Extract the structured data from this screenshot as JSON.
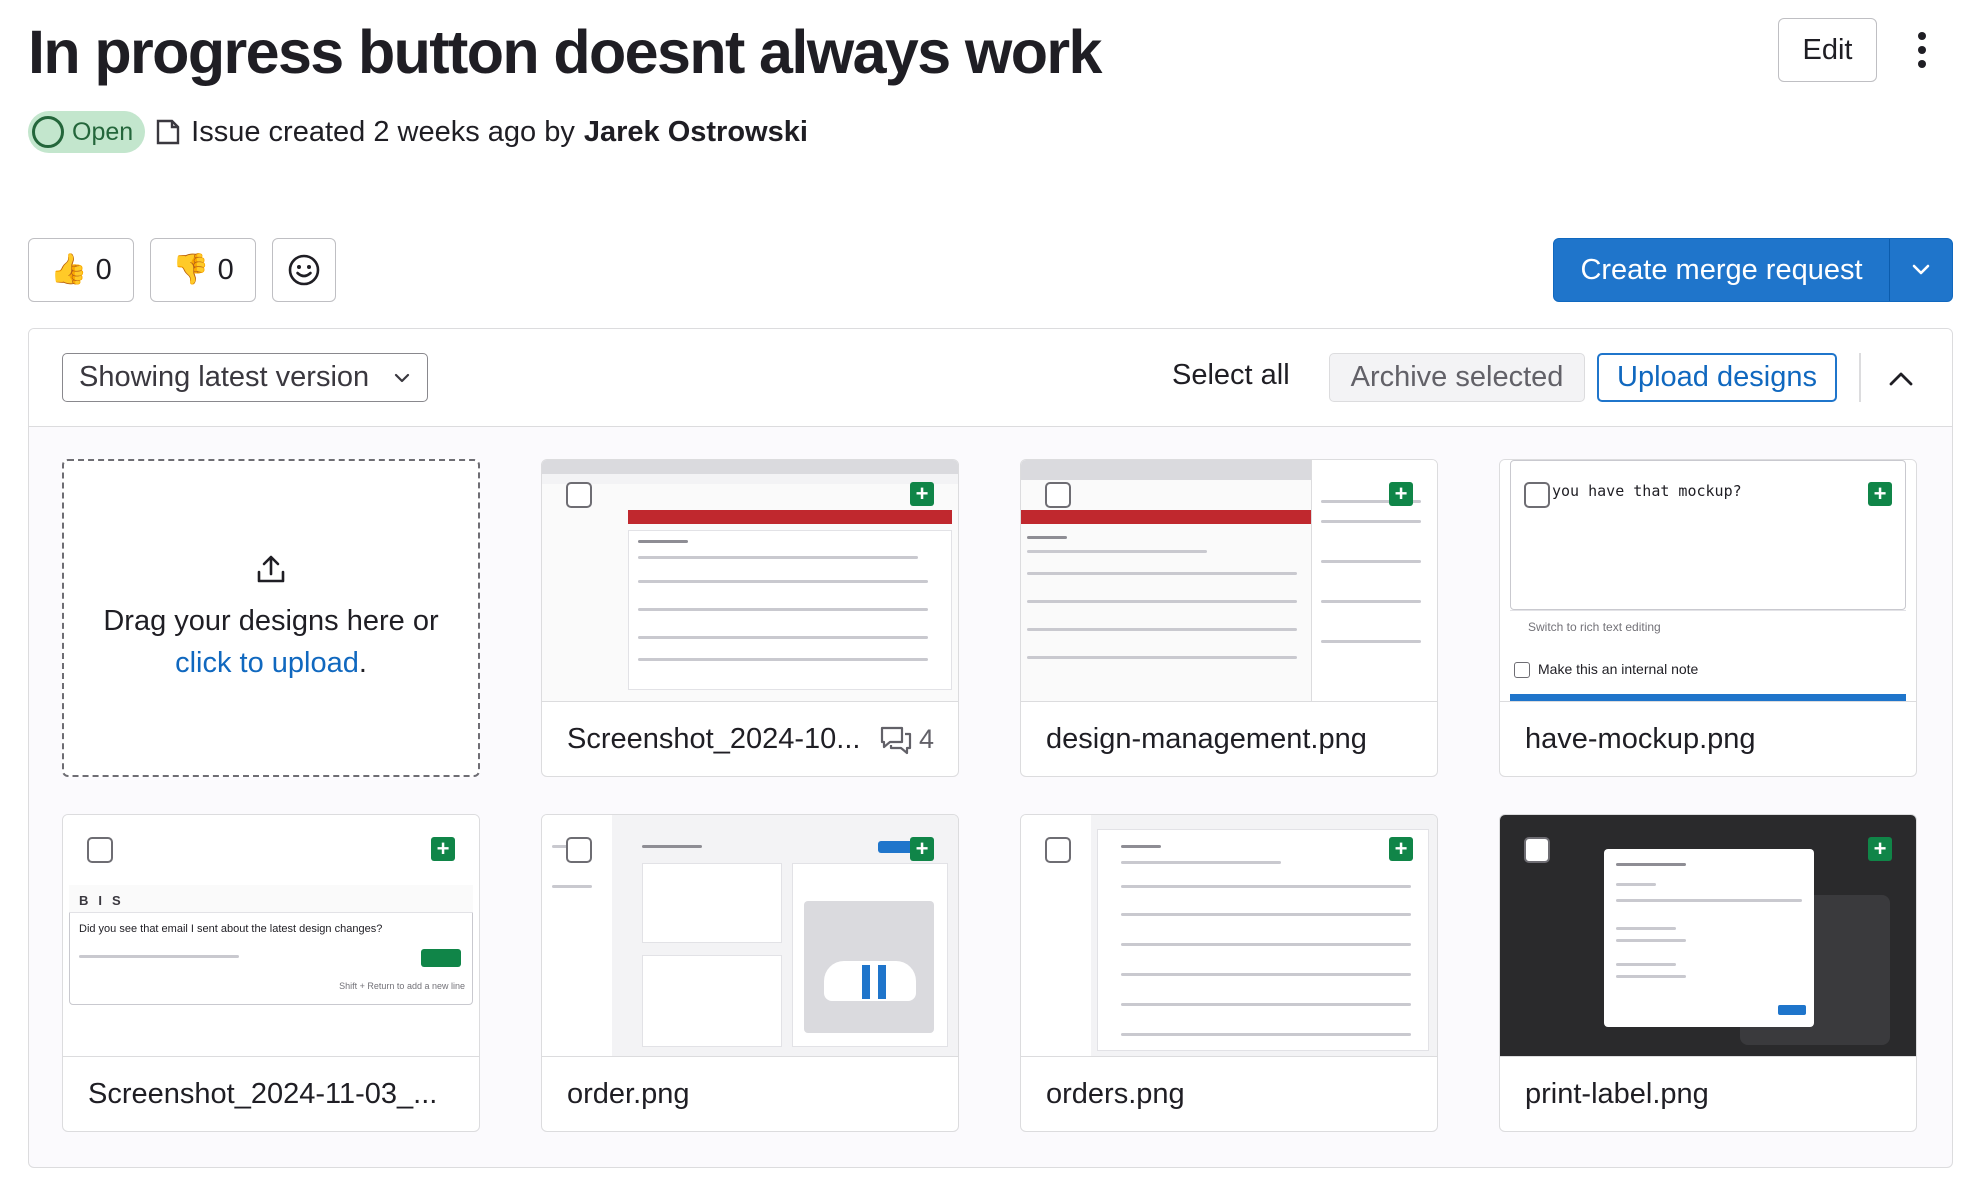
{
  "issue": {
    "title": "In progress button doesnt always work",
    "edit_label": "Edit",
    "status": "Open",
    "created_text": "Issue created 2 weeks ago by",
    "author": "Jarek Ostrowski"
  },
  "reactions": {
    "thumbs_up": {
      "emoji": "👍",
      "count": "0"
    },
    "thumbs_down": {
      "emoji": "👎",
      "count": "0"
    },
    "add_icon": "smiley-icon"
  },
  "merge_request": {
    "label": "Create merge request"
  },
  "designs": {
    "version_label": "Showing latest version",
    "select_all": "Select all",
    "archive_label": "Archive selected",
    "upload_label": "Upload designs",
    "dropzone": {
      "text": "Drag your designs here or",
      "link": "click to upload",
      "suffix": "."
    },
    "items": [
      {
        "name": "Screenshot_2024-10...",
        "notes": "4"
      },
      {
        "name": "design-management.png"
      },
      {
        "name": "have-mockup.png",
        "preview_text": "you have that mockup?",
        "preview_hint": "Switch to rich text editing",
        "preview_checkbox": "Make this an internal note"
      },
      {
        "name": "Screenshot_2024-11-03_...",
        "preview_text": "Did you see that email I sent about the latest design changes?",
        "preview_hint": "Shift + Return to add a new line"
      },
      {
        "name": "order.png"
      },
      {
        "name": "orders.png"
      },
      {
        "name": "print-label.png"
      }
    ]
  },
  "colors": {
    "accent": "#1f75cb",
    "status_bg": "#c3e6cd",
    "status_fg": "#24663b",
    "add_green": "#108548"
  }
}
